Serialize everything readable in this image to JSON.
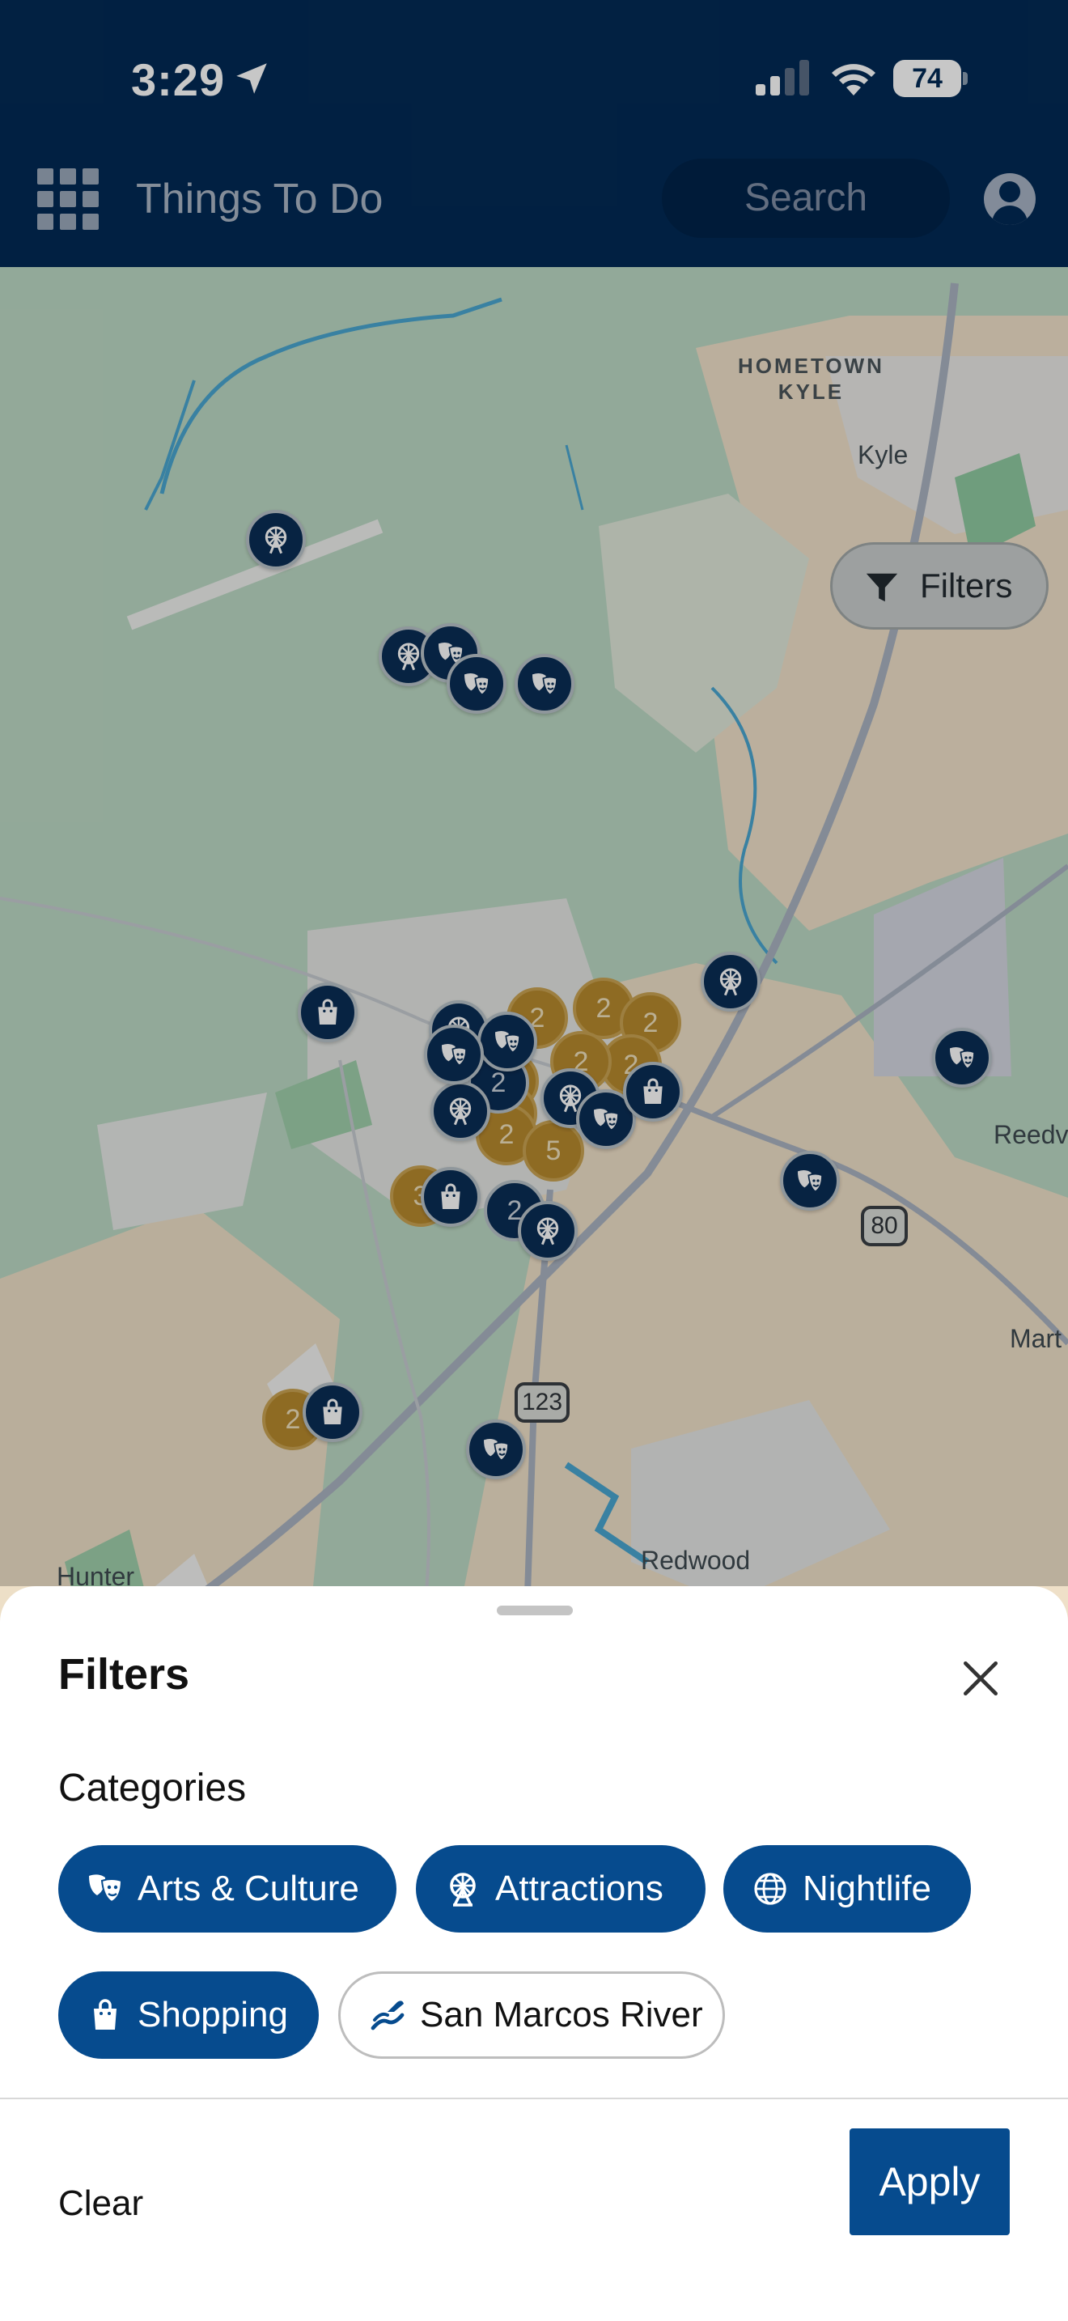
{
  "status_bar": {
    "time": "3:29",
    "battery": "74",
    "icons": [
      "location-arrow-icon",
      "cellular-signal-icon",
      "wifi-icon",
      "battery-icon"
    ]
  },
  "header": {
    "menu_icon": "grid-menu-icon",
    "title": "Things To Do",
    "search_placeholder": "Search",
    "account_icon": "account-icon"
  },
  "map": {
    "filters_button": "Filters",
    "labels": {
      "hometown_kyle_line1": "HOMETOWN",
      "hometown_kyle_line2": "KYLE",
      "kyle": "Kyle",
      "reedv": "Reedv",
      "mart": "Mart",
      "hunter": "Hunter",
      "redwood": "Redwood"
    },
    "shields": {
      "route_80": "80",
      "route_123": "123"
    },
    "cluster_counts": [
      "2",
      "2",
      "2",
      "2",
      "2",
      "2",
      "2",
      "3",
      "2",
      "5",
      "2",
      "2",
      "2"
    ]
  },
  "filters_sheet": {
    "title": "Filters",
    "section": "Categories",
    "categories": [
      {
        "label": "Arts & Culture",
        "icon": "theater-masks-icon",
        "selected": true
      },
      {
        "label": "Attractions",
        "icon": "ferris-wheel-icon",
        "selected": true
      },
      {
        "label": "Nightlife",
        "icon": "globe-icon",
        "selected": true
      },
      {
        "label": "Shopping",
        "icon": "shopping-bag-icon",
        "selected": true
      },
      {
        "label": "San Marcos River",
        "icon": "river-icon",
        "selected": false
      }
    ],
    "clear_label": "Clear",
    "apply_label": "Apply"
  },
  "colors": {
    "header_bg": "#022a55",
    "primary": "#064b8e",
    "pin": "#0a2d55",
    "cluster": "#b7892e",
    "map_green": "#8ab89d",
    "map_road": "#a9b2c0"
  }
}
